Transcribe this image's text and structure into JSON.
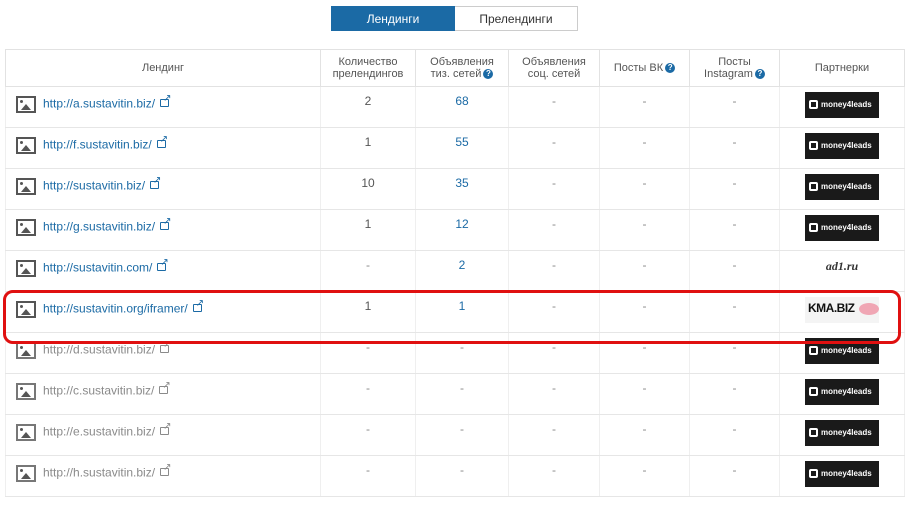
{
  "tabs": [
    {
      "label": "Лендинги",
      "active": true
    },
    {
      "label": "Прелендинги",
      "active": false
    }
  ],
  "columns": {
    "landing": "Лендинг",
    "prelanding_count_1": "Количество",
    "prelanding_count_2": "прелендингов",
    "teaser_ads_1": "Объявления",
    "teaser_ads_2": "тиз. сетей",
    "social_ads_1": "Объявления",
    "social_ads_2": "соц. сетей",
    "vk_posts": "Посты ВК",
    "instagram_1": "Посты",
    "instagram_2": "Instagram",
    "partners": "Партнерки"
  },
  "help_glyph": "?",
  "rows": [
    {
      "url": "http://a.sustavitin.biz/",
      "prelandings": "2",
      "teaser": "68",
      "social": "-",
      "vk": "-",
      "instagram": "-",
      "partner": "moneyleads",
      "partner_label": "money4leads",
      "dim": false
    },
    {
      "url": "http://f.sustavitin.biz/",
      "prelandings": "1",
      "teaser": "55",
      "social": "-",
      "vk": "-",
      "instagram": "-",
      "partner": "moneyleads",
      "partner_label": "money4leads",
      "dim": false
    },
    {
      "url": "http://sustavitin.biz/",
      "prelandings": "10",
      "teaser": "35",
      "social": "-",
      "vk": "-",
      "instagram": "-",
      "partner": "moneyleads",
      "partner_label": "money4leads",
      "dim": false
    },
    {
      "url": "http://g.sustavitin.biz/",
      "prelandings": "1",
      "teaser": "12",
      "social": "-",
      "vk": "-",
      "instagram": "-",
      "partner": "moneyleads",
      "partner_label": "money4leads",
      "dim": false
    },
    {
      "url": "http://sustavitin.com/",
      "prelandings": "-",
      "teaser": "2",
      "social": "-",
      "vk": "-",
      "instagram": "-",
      "partner": "ad1",
      "partner_label": "ad1.ru",
      "dim": false
    },
    {
      "url": "http://sustavitin.org/iframer/",
      "prelandings": "1",
      "teaser": "1",
      "social": "-",
      "vk": "-",
      "instagram": "-",
      "partner": "kma",
      "partner_label": "KMA.BIZ",
      "dim": false
    },
    {
      "url": "http://d.sustavitin.biz/",
      "prelandings": "-",
      "teaser": "-",
      "social": "-",
      "vk": "-",
      "instagram": "-",
      "partner": "moneyleads",
      "partner_label": "money4leads",
      "dim": true
    },
    {
      "url": "http://c.sustavitin.biz/",
      "prelandings": "-",
      "teaser": "-",
      "social": "-",
      "vk": "-",
      "instagram": "-",
      "partner": "moneyleads",
      "partner_label": "money4leads",
      "dim": true
    },
    {
      "url": "http://e.sustavitin.biz/",
      "prelandings": "-",
      "teaser": "-",
      "social": "-",
      "vk": "-",
      "instagram": "-",
      "partner": "moneyleads",
      "partner_label": "money4leads",
      "dim": true
    },
    {
      "url": "http://h.sustavitin.biz/",
      "prelandings": "-",
      "teaser": "-",
      "social": "-",
      "vk": "-",
      "instagram": "-",
      "partner": "moneyleads",
      "partner_label": "money4leads",
      "dim": true
    }
  ],
  "highlight_row": 5,
  "colors": {
    "accent": "#1b6aa5",
    "highlight": "#e01010"
  }
}
